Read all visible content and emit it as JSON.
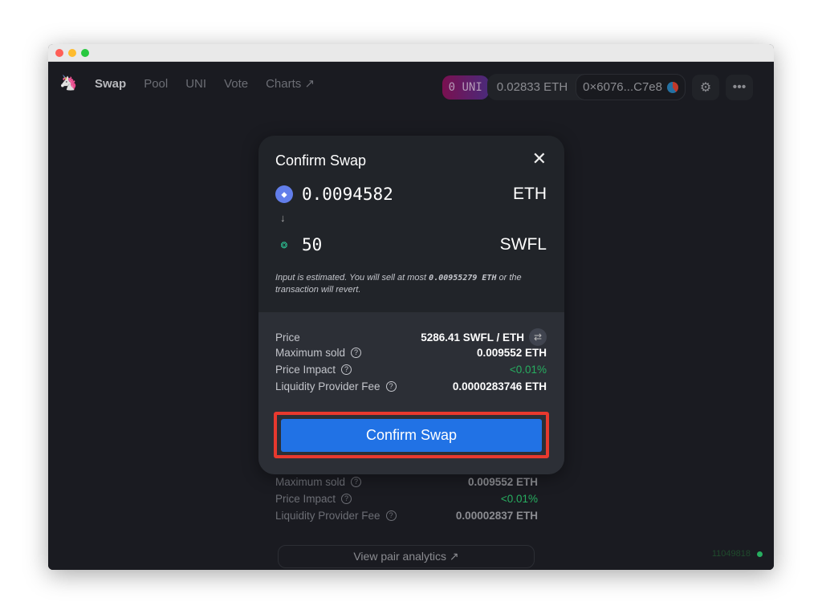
{
  "window": {
    "controls": {
      "close": "#ff5f57",
      "minimize": "#febc2e",
      "maximize": "#28c840"
    }
  },
  "nav": {
    "items": [
      "Swap",
      "Pool",
      "UNI",
      "Vote",
      "Charts ↗"
    ],
    "active": "Swap"
  },
  "header": {
    "uni_balance": "0 UNI",
    "eth_balance": "0.02833 ETH",
    "address": "0×6076...C7e8",
    "settings_icon": "gear-icon",
    "more_icon": "ellipsis-icon"
  },
  "modal": {
    "title": "Confirm Swap",
    "input": {
      "amount": "0.0094582",
      "symbol": "ETH"
    },
    "output": {
      "amount": "50",
      "symbol": "SWFL"
    },
    "note_pre": "Input is estimated. You will sell at most ",
    "note_amount": "0.00955279 ETH",
    "note_post": " or the transaction will revert.",
    "details": [
      {
        "label": "Price",
        "value": "5286.41 SWFL / ETH"
      },
      {
        "label": "Maximum sold",
        "value": "0.009552 ETH"
      },
      {
        "label": "Price Impact",
        "value": "<0.01%"
      },
      {
        "label": "Liquidity Provider Fee",
        "value": "0.0000283746 ETH"
      }
    ],
    "confirm_label": "Confirm Swap"
  },
  "background_panel": {
    "details": [
      {
        "label": "Maximum sold",
        "value": "0.009552 ETH"
      },
      {
        "label": "Price Impact",
        "value": "<0.01%"
      },
      {
        "label": "Liquidity Provider Fee",
        "value": "0.00002837 ETH"
      }
    ],
    "analytics_label": "View pair analytics ↗"
  },
  "block_number": "11049818",
  "colors": {
    "accent": "#2172e5",
    "highlight": "#e8392e",
    "positive": "#27ae60"
  }
}
